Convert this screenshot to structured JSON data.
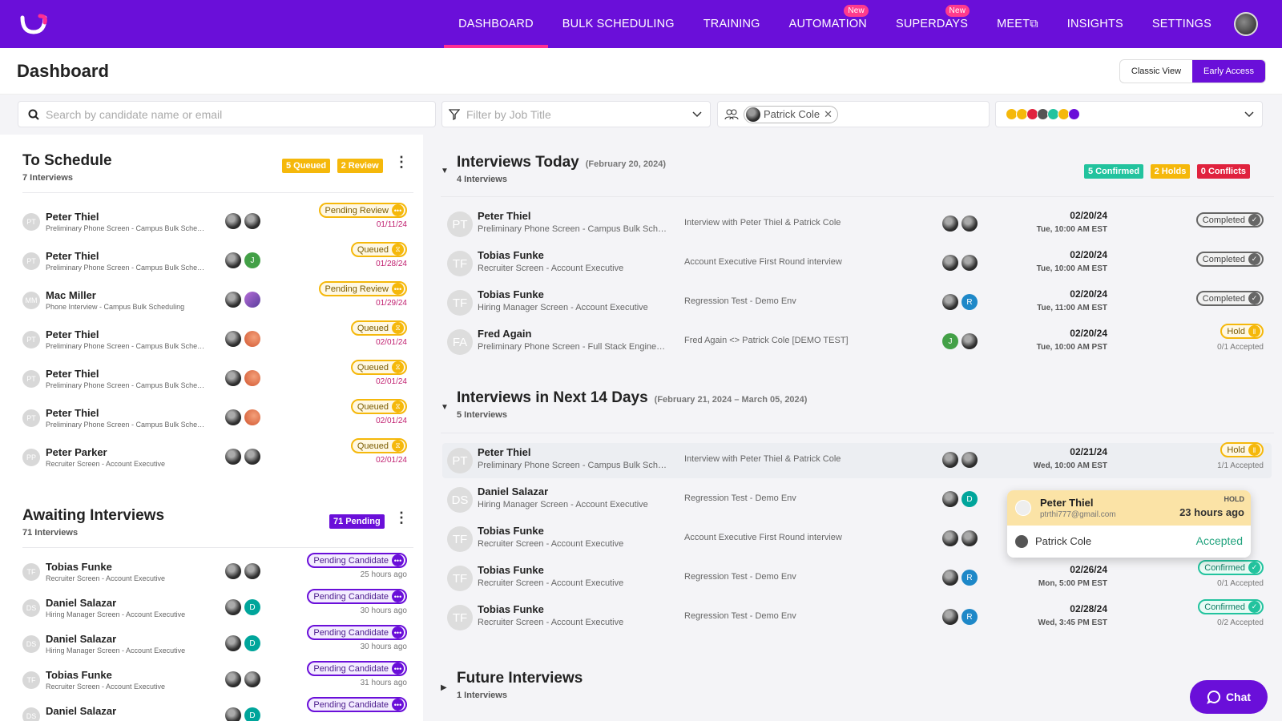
{
  "nav": {
    "items": [
      {
        "label": "DASHBOARD",
        "active": true
      },
      {
        "label": "BULK SCHEDULING"
      },
      {
        "label": "TRAINING"
      },
      {
        "label": "AUTOMATION",
        "badge": "New"
      },
      {
        "label": "SUPERDAYS",
        "badge": "New"
      },
      {
        "label": "MEET",
        "external": true
      },
      {
        "label": "INSIGHTS"
      },
      {
        "label": "SETTINGS"
      }
    ],
    "accent": "#6a0fd9"
  },
  "header": {
    "title": "Dashboard",
    "classic_view": "Classic View",
    "early_access": "Early Access"
  },
  "filters": {
    "search_placeholder": "Search by candidate name or email",
    "job_placeholder": "Filter by Job Title",
    "user_chip": "Patrick Cole"
  },
  "to_schedule": {
    "title": "To Schedule",
    "subtitle": "7 Interviews",
    "queued_tag": "5 Queued",
    "review_tag": "2 Review",
    "rows": [
      {
        "initials": "PT",
        "name": "Peter Thiel",
        "sub": "Preliminary Phone Screen - Campus Bulk Scheduling",
        "status": "Pending Review",
        "date": "01/11/24",
        "av2": "face"
      },
      {
        "initials": "PT",
        "name": "Peter Thiel",
        "sub": "Preliminary Phone Screen - Campus Bulk Scheduling",
        "status": "Queued",
        "date": "01/28/24",
        "av2": "J"
      },
      {
        "initials": "MM",
        "name": "Mac Miller",
        "sub": "Phone Interview - Campus Bulk Scheduling",
        "status": "Pending Review",
        "date": "01/29/24",
        "av2": "p"
      },
      {
        "initials": "PT",
        "name": "Peter Thiel",
        "sub": "Preliminary Phone Screen - Campus Bulk Scheduling",
        "status": "Queued",
        "date": "02/01/24",
        "av2": "o"
      },
      {
        "initials": "PT",
        "name": "Peter Thiel",
        "sub": "Preliminary Phone Screen - Campus Bulk Scheduling",
        "status": "Queued",
        "date": "02/01/24",
        "av2": "o"
      },
      {
        "initials": "PT",
        "name": "Peter Thiel",
        "sub": "Preliminary Phone Screen - Campus Bulk Scheduling",
        "status": "Queued",
        "date": "02/01/24",
        "av2": "o"
      },
      {
        "initials": "PP",
        "name": "Peter Parker",
        "sub": "Recruiter Screen - Account Executive",
        "status": "Queued",
        "date": "02/01/24",
        "av2": "face"
      }
    ]
  },
  "awaiting": {
    "title": "Awaiting Interviews",
    "subtitle": "71 Interviews",
    "pending_tag": "71 Pending",
    "rows": [
      {
        "initials": "TF",
        "name": "Tobias Funke",
        "sub": "Recruiter Screen - Account Executive",
        "status": "Pending Candidate",
        "time": "25 hours ago",
        "av2": "face"
      },
      {
        "initials": "DS",
        "name": "Daniel Salazar",
        "sub": "Hiring Manager Screen - Account Executive",
        "status": "Pending Candidate",
        "time": "30 hours ago",
        "av2": "D"
      },
      {
        "initials": "DS",
        "name": "Daniel Salazar",
        "sub": "Hiring Manager Screen - Account Executive",
        "status": "Pending Candidate",
        "time": "30 hours ago",
        "av2": "D"
      },
      {
        "initials": "TF",
        "name": "Tobias Funke",
        "sub": "Recruiter Screen - Account Executive",
        "status": "Pending Candidate",
        "time": "31 hours ago",
        "av2": "face"
      },
      {
        "initials": "DS",
        "name": "Daniel Salazar",
        "sub": "",
        "status": "Pending Candidate",
        "time": "",
        "av2": "D"
      }
    ]
  },
  "today": {
    "title": "Interviews Today",
    "date": "(February 20, 2024)",
    "subtitle": "4 Interviews",
    "confirmed_tag": "5 Confirmed",
    "holds_tag": "2 Holds",
    "conflicts_tag": "0 Conflicts",
    "rows": [
      {
        "initials": "PT",
        "name": "Peter Thiel",
        "sub": "Preliminary Phone Screen - Campus Bulk Scheduling",
        "desc": "Interview with Peter Thiel & Patrick Cole",
        "date": "02/20/24",
        "time": "Tue, 10:00 AM EST",
        "status": "Completed",
        "accepted": "",
        "av1": "face",
        "av2": "face"
      },
      {
        "initials": "TF",
        "name": "Tobias Funke",
        "sub": "Recruiter Screen - Account Executive",
        "desc": "Account Executive First Round interview",
        "date": "02/20/24",
        "time": "Tue, 10:00 AM EST",
        "status": "Completed",
        "accepted": "",
        "av1": "face",
        "av2": "face"
      },
      {
        "initials": "TF",
        "name": "Tobias Funke",
        "sub": "Hiring Manager Screen - Account Executive",
        "desc": "Regression Test - Demo Env",
        "date": "02/20/24",
        "time": "Tue, 11:00 AM EST",
        "status": "Completed",
        "accepted": "",
        "av1": "face",
        "av2": "R"
      },
      {
        "initials": "FA",
        "name": "Fred Again",
        "sub": "Preliminary Phone Screen - Full Stack Engineer (Remote)",
        "desc": "Fred Again <> Patrick Cole [DEMO TEST]",
        "date": "02/20/24",
        "time": "Tue, 10:00 AM PST",
        "status": "Hold",
        "accepted": "0/1 Accepted",
        "av1": "J",
        "av2": "face"
      }
    ]
  },
  "next14": {
    "title": "Interviews in Next 14 Days",
    "date": "(February 21, 2024 – March 05, 2024)",
    "subtitle": "5 Interviews",
    "rows": [
      {
        "initials": "PT",
        "name": "Peter Thiel",
        "sub": "Preliminary Phone Screen - Campus Bulk Scheduling",
        "desc": "Interview with Peter Thiel & Patrick Cole",
        "date": "02/21/24",
        "time": "Wed, 10:00 AM EST",
        "status": "Hold",
        "accepted": "1/1 Accepted",
        "av1": "face",
        "av2": "face",
        "hl": true
      },
      {
        "initials": "DS",
        "name": "Daniel Salazar",
        "sub": "Hiring Manager Screen - Account Executive",
        "desc": "Regression Test - Demo Env",
        "date": "",
        "time": "",
        "status": "",
        "accepted": "",
        "av1": "face",
        "av2": "D"
      },
      {
        "initials": "TF",
        "name": "Tobias Funke",
        "sub": "Recruiter Screen - Account Executive",
        "desc": "Account Executive First Round interview",
        "date": "",
        "time": "",
        "status": "",
        "accepted": "",
        "av1": "face",
        "av2": "face"
      },
      {
        "initials": "TF",
        "name": "Tobias Funke",
        "sub": "Recruiter Screen - Account Executive",
        "desc": "Regression Test - Demo Env",
        "date": "02/26/24",
        "time": "Mon, 5:00 PM EST",
        "status": "Confirmed",
        "accepted": "0/1 Accepted",
        "av1": "face",
        "av2": "R"
      },
      {
        "initials": "TF",
        "name": "Tobias Funke",
        "sub": "Recruiter Screen - Account Executive",
        "desc": "Regression Test - Demo Env",
        "date": "02/28/24",
        "time": "Wed, 3:45 PM EST",
        "status": "Confirmed",
        "accepted": "0/2 Accepted",
        "av1": "face",
        "av2": "R"
      }
    ]
  },
  "popup": {
    "name": "Peter Thiel",
    "email": "ptrthi777@gmail.com",
    "label": "HOLD",
    "time": "23 hours ago",
    "member": "Patrick Cole",
    "member_status": "Accepted"
  },
  "future": {
    "title": "Future Interviews",
    "subtitle": "1 Interviews"
  },
  "chat": {
    "label": "Chat"
  }
}
